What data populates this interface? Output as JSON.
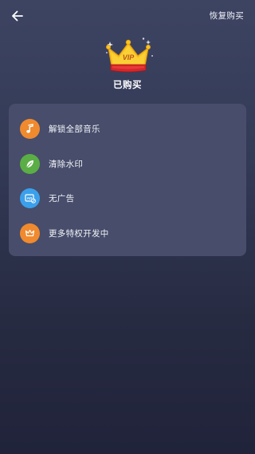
{
  "header": {
    "back_icon": "arrow-left-icon",
    "restore_label": "恢复购买"
  },
  "hero": {
    "crown_icon": "vip-crown-icon",
    "crown_text": "VIP",
    "status_label": "已购买"
  },
  "features": [
    {
      "label": "解锁全部音乐",
      "icon": "music-note-icon",
      "color": "#f08a2e"
    },
    {
      "label": "清除水印",
      "icon": "leaf-icon",
      "color": "#5aae45"
    },
    {
      "label": "无广告",
      "icon": "no-ads-icon",
      "color": "#3ba0ec"
    },
    {
      "label": "更多特权开发中",
      "icon": "crown-icon",
      "color": "#f08a2e"
    }
  ],
  "colors": {
    "background_top": "#3d4462",
    "background_bottom": "#20233a",
    "card": "#474d6b",
    "crown_gold": "#f7c51e",
    "crown_red": "#d8262b"
  }
}
